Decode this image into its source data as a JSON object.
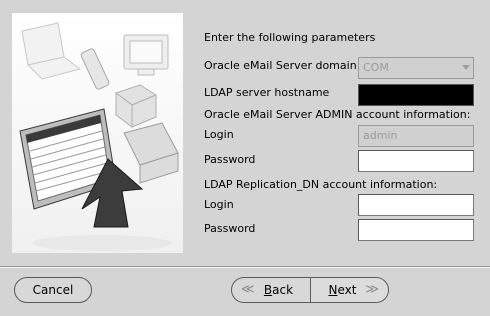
{
  "header": {
    "prompt": "Enter the following parameters"
  },
  "domain": {
    "label": "Oracle eMail Server domain",
    "value": "COM"
  },
  "ldap": {
    "label": "LDAP server hostname",
    "value": ""
  },
  "admin": {
    "section": "Oracle eMail Server ADMIN account information:",
    "login_label": "Login",
    "login_value": "admin",
    "password_label": "Password",
    "password_value": ""
  },
  "replication": {
    "section": "LDAP Replication_DN account information:",
    "login_label": "Login",
    "login_value": "",
    "password_label": "Password",
    "password_value": ""
  },
  "buttons": {
    "cancel": "Cancel",
    "back_mnemonic": "B",
    "back_rest": "ack",
    "next_mnemonic": "N",
    "next_rest": "ext"
  }
}
